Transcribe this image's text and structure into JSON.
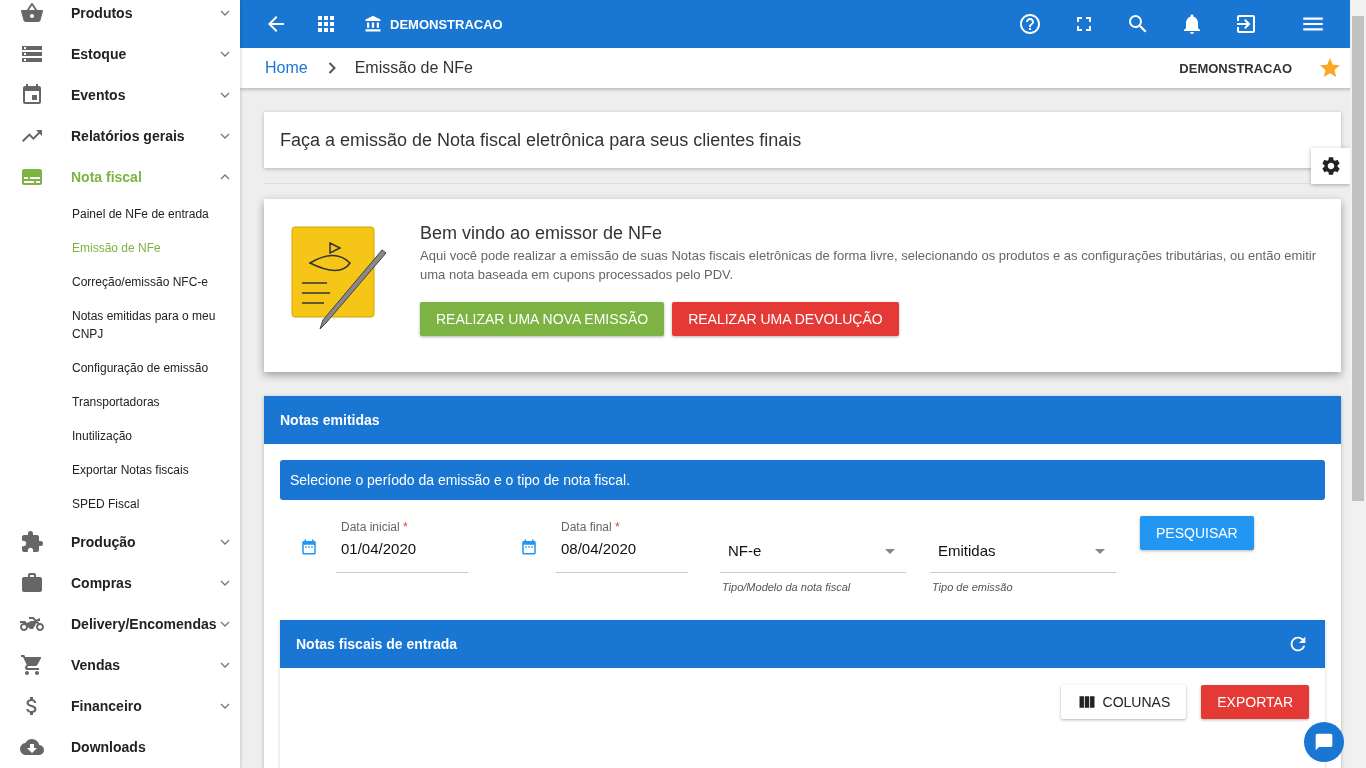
{
  "sidebar": {
    "items": [
      {
        "label": "Produtos",
        "selected": false,
        "expanded": false,
        "has_submenu": true
      },
      {
        "label": "Estoque",
        "selected": false,
        "expanded": false,
        "has_submenu": true
      },
      {
        "label": "Eventos",
        "selected": false,
        "expanded": false,
        "has_submenu": true
      },
      {
        "label": "Relatórios gerais",
        "selected": false,
        "expanded": false,
        "has_submenu": true
      },
      {
        "label": "Nota fiscal",
        "selected": true,
        "expanded": true,
        "has_submenu": true,
        "children": [
          {
            "label": "Painel de NFe de entrada",
            "selected": false
          },
          {
            "label": "Emissão de NFe",
            "selected": true
          },
          {
            "label": "Correção/emissão NFC-e",
            "selected": false
          },
          {
            "label": "Notas emitidas para o meu CNPJ",
            "selected": false
          },
          {
            "label": "Configuração de emissão",
            "selected": false
          },
          {
            "label": "Transportadoras",
            "selected": false
          },
          {
            "label": "Inutilização",
            "selected": false
          },
          {
            "label": "Exportar Notas fiscais",
            "selected": false
          },
          {
            "label": "SPED Fiscal",
            "selected": false
          }
        ]
      },
      {
        "label": "Produção",
        "selected": false,
        "expanded": false,
        "has_submenu": true
      },
      {
        "label": "Compras",
        "selected": false,
        "expanded": false,
        "has_submenu": true
      },
      {
        "label": "Delivery/Encomendas",
        "selected": false,
        "expanded": false,
        "has_submenu": true
      },
      {
        "label": "Vendas",
        "selected": false,
        "expanded": false,
        "has_submenu": true
      },
      {
        "label": "Financeiro",
        "selected": false,
        "expanded": false,
        "has_submenu": true
      },
      {
        "label": "Downloads",
        "selected": false,
        "has_submenu": false
      }
    ]
  },
  "topbar": {
    "company": "DEMONSTRACAO"
  },
  "breadcrumb": {
    "items": [
      "Home",
      "Emissão de NFe"
    ],
    "company": "DEMONSTRACAO",
    "favorite": true
  },
  "intro": "Faça a emissão de Nota fiscal eletrônica para seus clientes finais",
  "welcome": {
    "title": "Bem vindo ao emissor de NFe",
    "text": "Aqui você pode realizar a emissão de suas Notas fiscais eletrônicas de forma livre, selecionando os produtos e as configurações tributárias, ou então emitir uma nota baseada em cupons processados pelo PDV.",
    "buttons": [
      {
        "label": "REALIZAR UMA NOVA EMISSÃO",
        "kind": "success"
      },
      {
        "label": "REALIZAR UMA DEVOLUÇÃO",
        "kind": "danger"
      }
    ]
  },
  "issued_panel": {
    "title": "Notas emitidas",
    "info": "Selecione o período da emissão e o tipo de nota fiscal.",
    "filters": [
      {
        "kind": "date",
        "label": "Data inicial",
        "required_mark": "*",
        "value": "01/04/2020"
      },
      {
        "kind": "date",
        "label": "Data final",
        "required_mark": "*",
        "value": "08/04/2020"
      },
      {
        "kind": "select",
        "value": "NF-e",
        "hint": "Tipo/Modelo da nota fiscal"
      },
      {
        "kind": "select",
        "value": "Emitidas",
        "hint": "Tipo de emissão"
      }
    ],
    "search_button": "PESQUISAR",
    "table_panel": {
      "title": "Notas fiscais de entrada",
      "buttons": [
        {
          "label": "COLUNAS",
          "kind": "outline"
        },
        {
          "label": "EXPORTAR",
          "kind": "danger"
        }
      ]
    }
  }
}
